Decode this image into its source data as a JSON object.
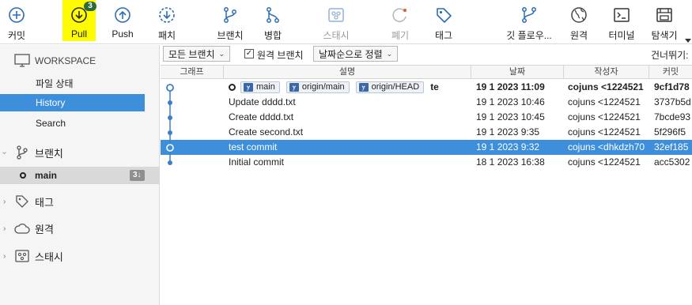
{
  "toolbar": {
    "commit": "커밋",
    "pull": "Pull",
    "pull_badge": "3",
    "push": "Push",
    "patch": "패치",
    "branch": "브랜치",
    "merge": "병합",
    "stash": "스태시",
    "discard": "폐기",
    "tag": "태그",
    "git_flow": "깃 플로우...",
    "remote": "원격",
    "terminal": "터미널",
    "explorer": "탐색기"
  },
  "sidebar": {
    "workspace": "WORKSPACE",
    "file_status": "파일 상태",
    "history": "History",
    "search": "Search",
    "branches": "브랜치",
    "main_branch": "main",
    "main_badge": "3↓",
    "tags": "태그",
    "remotes": "원격",
    "stashes": "스태시"
  },
  "filterbar": {
    "branch_filter": "모든 브랜치",
    "remote_branch_label": "원격 브랜치",
    "remote_branch_checked": true,
    "sort": "날짜순으로 정렬",
    "skip": "건너뛰기:"
  },
  "columns": {
    "graph": "그래프",
    "description": "설명",
    "date": "날짜",
    "author": "작성자",
    "commit": "커밋"
  },
  "head_refs": {
    "ref1": "main",
    "ref2": "origin/main",
    "ref3": "origin/HEAD",
    "message": "te"
  },
  "commits": [
    {
      "message": "te",
      "date": "19 1 2023 11:09",
      "author": "cojuns <1224521",
      "hash": "9cf1d78"
    },
    {
      "message": "Update dddd.txt",
      "date": "19 1 2023 10:46",
      "author": "cojuns <1224521",
      "hash": "3737b5d"
    },
    {
      "message": "Create dddd.txt",
      "date": "19 1 2023 10:45",
      "author": "cojuns <1224521",
      "hash": "7bcde93"
    },
    {
      "message": "Create second.txt",
      "date": "19 1 2023 9:35",
      "author": "cojuns <1224521",
      "hash": "5f296f5"
    },
    {
      "message": "test commit",
      "date": "19 1 2023 9:32",
      "author": "cojuns <dhkdzh70",
      "hash": "32ef185"
    },
    {
      "message": "Initial commit",
      "date": "18 1 2023 16:38",
      "author": "cojuns <1224521",
      "hash": "acc5302"
    }
  ],
  "colors": {
    "accent": "#3d8fdc",
    "pull_highlight": "#fffb00",
    "badge": "#2e6b3a"
  }
}
